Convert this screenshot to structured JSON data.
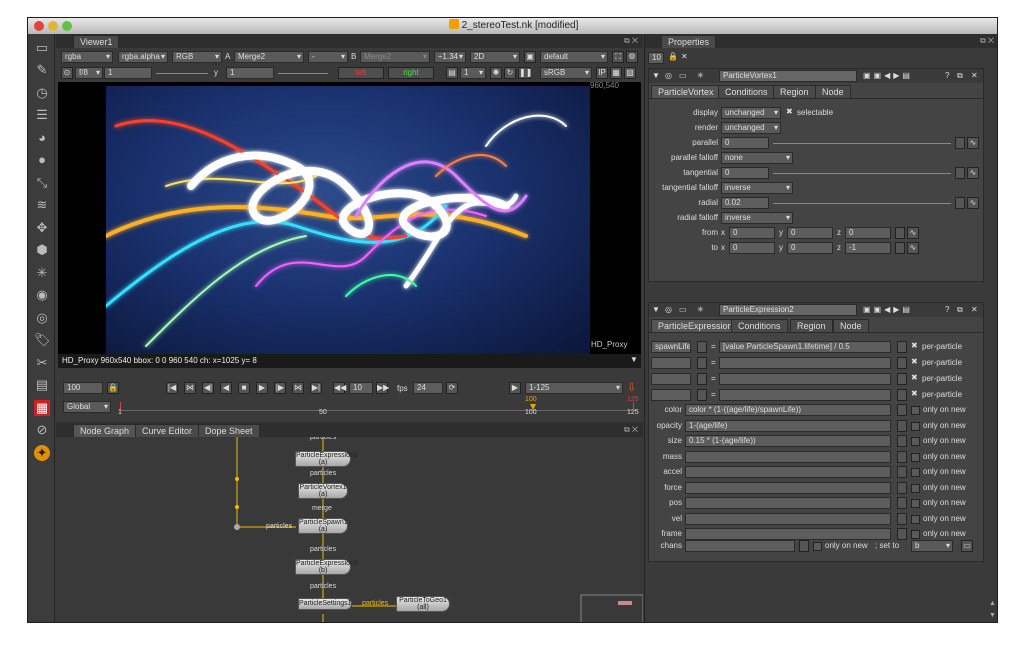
{
  "window": {
    "title": "2_stereoTest.nk [modified]"
  },
  "viewer": {
    "tab": "Viewer1",
    "channels": "rgba",
    "alpha": "rgba.alpha",
    "display": "RGB",
    "a_label": "A",
    "a_input": "Merge2",
    "op": "-",
    "b_label": "B",
    "b_input": "Merge2",
    "zoom": "÷1.34",
    "view_mode": "2D",
    "lut_preset": "default",
    "fstop": "f/8",
    "gain": "1",
    "y_label": "y",
    "gamma": "1",
    "left_view": "left",
    "right_view": "right",
    "proxy_scale": "1",
    "colorspace": "sRGB",
    "coord_top": "960,540",
    "proxy_label": "HD_Proxy",
    "info": "HD_Proxy 960x540 bbox: 0 0 960 540 ch:  x=1025 y=   8"
  },
  "timeline": {
    "frame": "100",
    "step": "10",
    "fps_label": "fps",
    "fps": "24",
    "range": "1-125",
    "scope": "Global",
    "ticks": [
      "1",
      "50",
      "100",
      "125"
    ],
    "marker_top_100": "100",
    "marker_top_125": "125"
  },
  "nodegraph": {
    "tabs": [
      "Node Graph",
      "Curve Editor",
      "Dope Sheet"
    ],
    "nodes": [
      {
        "label": "ParticleExpression1",
        "sub": "(a)"
      },
      {
        "label": "ParticleVortex1",
        "sub": "(a)"
      },
      {
        "label": "ParticleSpawn1",
        "sub": "(a)"
      },
      {
        "label": "ParticleExpression2",
        "sub": "(b)"
      },
      {
        "label": "ParticleSettings1",
        "sub": ""
      },
      {
        "label": "ParticleToGeo1",
        "sub": "(all)"
      }
    ],
    "wire_labels": [
      "particles",
      "particles",
      "particles",
      "merge",
      "particles",
      "particles",
      "particles"
    ]
  },
  "properties": {
    "tab": "Properties",
    "max_panels": "10",
    "vortex": {
      "name": "ParticleVortex1",
      "tabs": [
        "ParticleVortex",
        "Conditions",
        "Region",
        "Node"
      ],
      "display_label": "display",
      "display": "unchanged",
      "selectable": "selectable",
      "render_label": "render",
      "render": "unchanged",
      "parallel_label": "parallel",
      "parallel": "0",
      "parallel_falloff_label": "parallel falloff",
      "parallel_falloff": "none",
      "tangential_label": "tangential",
      "tangential": "0",
      "tangential_falloff_label": "tangential falloff",
      "tangential_falloff": "inverse",
      "radial_label": "radial",
      "radial": "0.02",
      "radial_falloff_label": "radial falloff",
      "radial_falloff": "inverse",
      "from_label": "from",
      "to_label": "to",
      "from": {
        "x": "0",
        "y": "0",
        "z": "0"
      },
      "to": {
        "x": "0",
        "y": "0",
        "z": "-1"
      },
      "x": "x",
      "y": "y",
      "z": "z"
    },
    "expr": {
      "name": "ParticleExpression2",
      "tabs": [
        "ParticleExpression",
        "Conditions",
        "Region",
        "Node"
      ],
      "custom": [
        {
          "name": "spawnLife",
          "expr": "[value ParticleSpawn1.lifetime] / 0.5",
          "opt": "per-particle"
        },
        {
          "name": "",
          "expr": "",
          "opt": "per-particle"
        },
        {
          "name": "",
          "expr": "",
          "opt": "per-particle"
        },
        {
          "name": "",
          "expr": "",
          "opt": "per-particle"
        }
      ],
      "eq": "=",
      "rows": [
        {
          "label": "color",
          "expr": "color * (1-((age/life)/spawnLife))",
          "opt": "only on new"
        },
        {
          "label": "opacity",
          "expr": "1-(age/life)",
          "opt": "only on new"
        },
        {
          "label": "size",
          "expr": "0.15 * (1-(age/life))",
          "opt": "only on new"
        },
        {
          "label": "mass",
          "expr": "",
          "opt": "only on new"
        },
        {
          "label": "accel",
          "expr": "",
          "opt": "only on new"
        },
        {
          "label": "force",
          "expr": "",
          "opt": "only on new"
        },
        {
          "label": "pos",
          "expr": "",
          "opt": "only on new"
        },
        {
          "label": "vel",
          "expr": "",
          "opt": "only on new"
        },
        {
          "label": "frame",
          "expr": "",
          "opt": "only on new"
        }
      ],
      "chans_label": "chans",
      "chans_opt": "only on new",
      "set_to_label": "; set to",
      "set_to": "b"
    }
  }
}
